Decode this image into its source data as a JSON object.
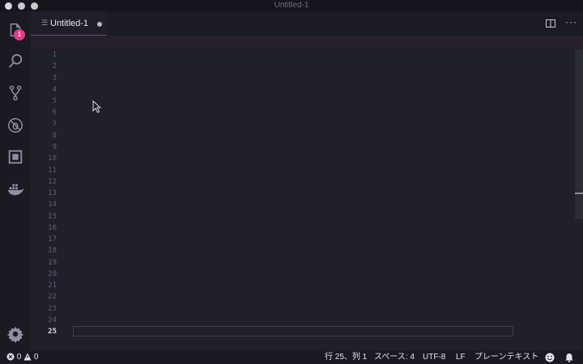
{
  "window": {
    "title": "Untitled-1"
  },
  "activity": {
    "icons": [
      "explorer-icon",
      "search-icon",
      "source-control-icon",
      "debug-icon",
      "extensions-icon",
      "docker-icon",
      "settings-gear-icon"
    ],
    "explorer_badge": "1"
  },
  "tabs": [
    {
      "label": "Untitled-1",
      "dirty": true
    }
  ],
  "editor": {
    "line_numbers": [
      "1",
      "2",
      "3",
      "4",
      "5",
      "6",
      "7",
      "8",
      "9",
      "10",
      "11",
      "12",
      "13",
      "14",
      "15",
      "16",
      "17",
      "18",
      "19",
      "20",
      "21",
      "22",
      "23",
      "24",
      "25"
    ],
    "active_line": "25"
  },
  "status": {
    "errors": "0",
    "warnings": "0",
    "position": "行 25、列 1",
    "indent": "スペース: 4",
    "encoding": "UTF-8",
    "eol": "LF",
    "language": "プレーンテキスト"
  },
  "colors": {
    "accent": "#e13a84",
    "tab_underline": "#8a3a7d",
    "editor_bg": "#1f2029"
  }
}
